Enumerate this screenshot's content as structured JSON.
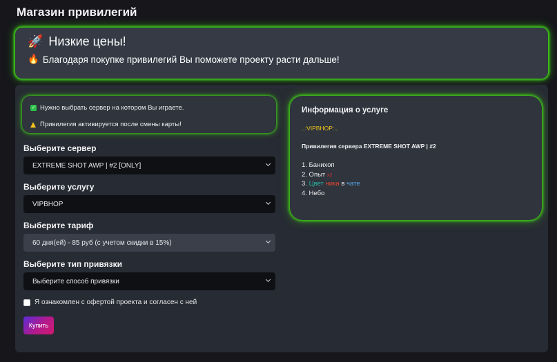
{
  "page": {
    "title": "Магазин привилегий"
  },
  "banner": {
    "title_icon": "rocket-icon",
    "title_emoji": "🚀",
    "title": "Низкие цены!",
    "subtitle_icon": "fire-icon",
    "subtitle_emoji": "🔥",
    "subtitle": "Благодаря покупке привилегий Вы поможете проекту расти дальше!"
  },
  "notice": {
    "line1": "Нужно выбрать сервер на котором Вы играете.",
    "line2": "Привилегия активируется после смены карты!",
    "check_glyph": "✓"
  },
  "form": {
    "server_label": "Выберите сервер",
    "server_value": "EXTREME SHOT AWP | #2 [ONLY]",
    "service_label": "Выберите услугу",
    "service_value": "VIPBHOP",
    "tariff_label": "Выберите тариф",
    "tariff_value": "60 дня(ей) - 85 руб (с учетом скидки в 15%)",
    "binding_label": "Выберите тип привязки",
    "binding_value": "Выберите способ привязки",
    "agree_text": "Я ознакомлен с офертой проекта и согласен с ней",
    "buy_button": "Купить"
  },
  "info": {
    "title": "Информация о услуге",
    "privilege": "..:VIPBHOP:..",
    "server_line": "Привилегия сервера EXTREME SHOT AWP | #2",
    "items": {
      "i1": "1. Банихоп",
      "i2_prefix": "2. Опыт",
      "i2_suffix": "x2",
      "i3_num": "3.",
      "i3_w1": "Цвет",
      "i3_w2": "ника",
      "i3_w3": "в",
      "i3_w4": "чате",
      "i4": "4. Небо"
    }
  },
  "colors": {
    "glow": "#41d71a",
    "accent_yellow": "#f0c419",
    "button_start": "#5a2bd8",
    "button_end": "#d1196f"
  }
}
